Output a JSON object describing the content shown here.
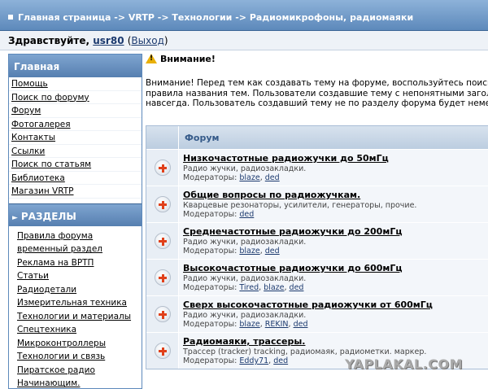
{
  "header": {
    "breadcrumb": "Главная страница -> VRTP -> Технологии -> Радиомикрофоны, радиомаяки"
  },
  "user": {
    "greeting": "Здравствуйте,",
    "username": "usr80",
    "paren_open": "(",
    "logout": "Выход",
    "paren_close": ")"
  },
  "sidebar": {
    "main_title": "Главная",
    "links": [
      "Помощь",
      "Поиск по форуму",
      "Форум",
      "Фотогалерея",
      "Контакты",
      "Ссылки",
      "Поиск по статьям",
      "Библиотека",
      "Магазин VRTP"
    ],
    "sections_title": "РАЗДЕЛЫ",
    "sections": [
      "Правила форума",
      "временный раздел",
      "Реклама на ВРТП",
      "Статьи",
      "Радиодетали",
      "Измерительная техника",
      "Технологии и материалы",
      "Спецтехника",
      "Микроконтроллеры",
      "Технологии и связь",
      "Пиратское радио",
      "Начинающим."
    ]
  },
  "notice": {
    "title": "Внимание!",
    "line1": "Внимание! Перед тем как создавать тему на форуме, воспользуйтесь поиском",
    "line2": "правила названия тем. Пользователи создавшие тему с непонятными заголов",
    "line3": "навсегда. Пользователь создавший тему не по разделу форума будет немед"
  },
  "forum": {
    "header": "Форум",
    "mods_label": "Модераторы:",
    "rows": [
      {
        "title": "Низкочастотные радиожучки до 50мГц",
        "desc": "Радио жучки, радиозакладки.",
        "mods": [
          "blaze",
          "ded"
        ]
      },
      {
        "title": "Общие вопросы по радиожучкам.",
        "desc": "Кварцевые резонаторы, усилители, генераторы, прочие.",
        "mods": [
          "ded"
        ]
      },
      {
        "title": "Среднечастотные радиожучки до 200мГц",
        "desc": "Радио жучки, радиозакладки.",
        "mods": [
          "blaze",
          "ded"
        ]
      },
      {
        "title": "Высокочастотные радиожучки до 600мГц",
        "desc": "Радио жучки, радиозакладки.",
        "mods": [
          "Tired",
          "blaze",
          "ded"
        ]
      },
      {
        "title": "Сверх высокочастотные радиожучки от 600мГц",
        "desc": "Радио жучки, радиозакладки.",
        "mods": [
          "blaze",
          "REKIN",
          "ded"
        ]
      },
      {
        "title": "Радиомаяки, трассеры.",
        "desc": "Трассер (tracker) tracking, радиомаяк, радиометки. маркер.",
        "mods": [
          "Eddy71",
          "ded"
        ]
      }
    ]
  },
  "watermark": "YAPLAKAL.COM",
  "icons": {
    "warning": "warning-icon",
    "expand": "plus-icon"
  },
  "colors": {
    "header_blue": "#5d89bb",
    "link": "#1c3a6e",
    "plus_red": "#e0401a"
  }
}
